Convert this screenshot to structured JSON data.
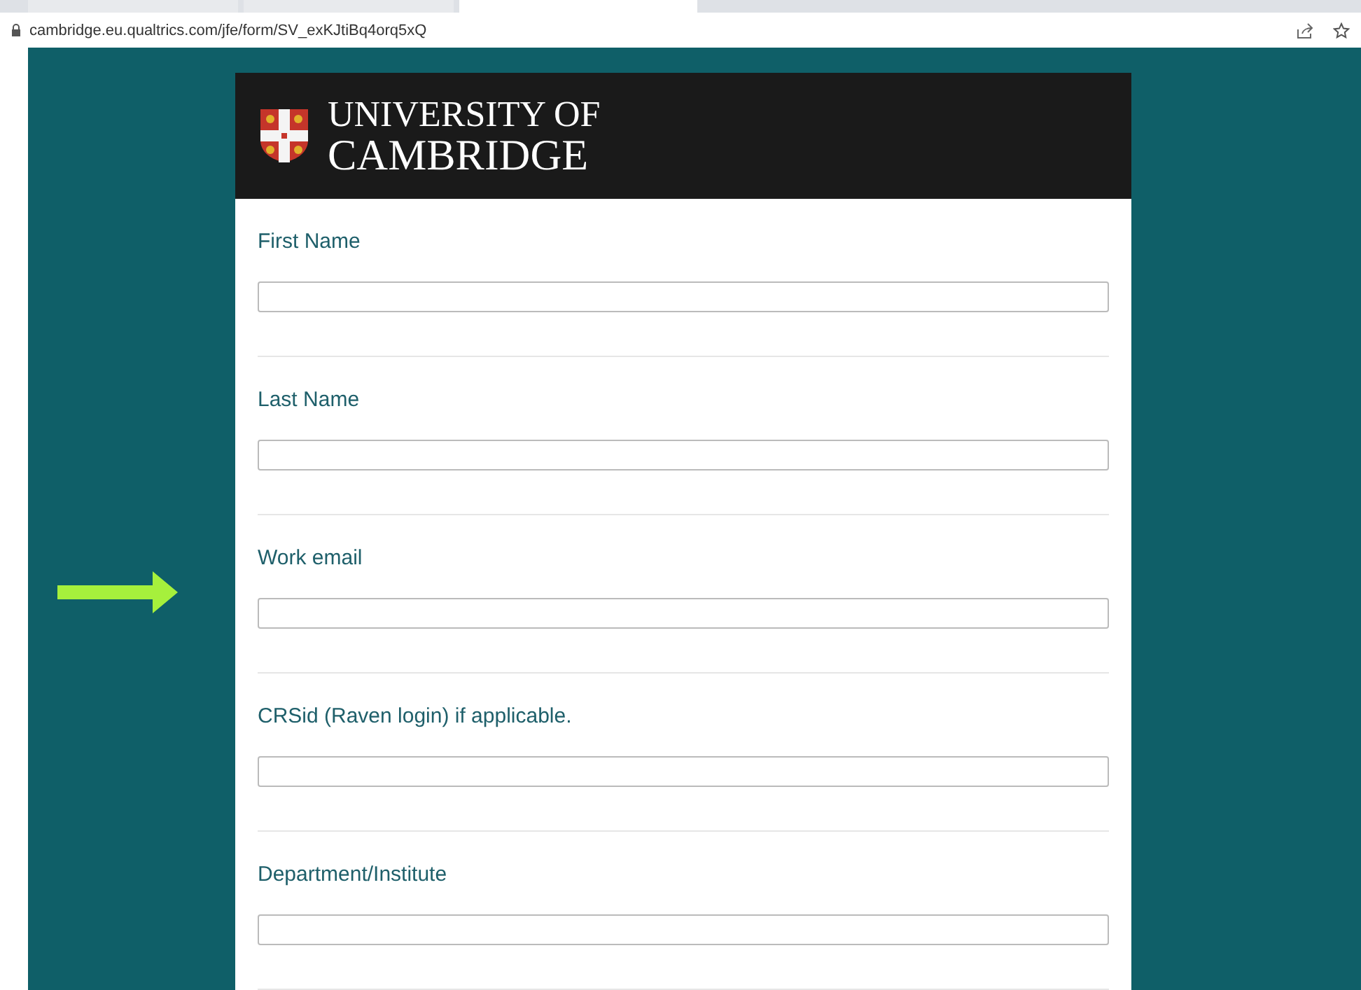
{
  "browser": {
    "tabs": [
      {
        "selected": false
      },
      {
        "selected": false
      },
      {
        "selected": true
      }
    ],
    "url": "cambridge.eu.qualtrics.com/jfe/form/SV_exKJtiBq4orq5xQ"
  },
  "header": {
    "logo_line_1": "UNIVERSITY OF",
    "logo_line_2": "CAMBRIDGE"
  },
  "questions": [
    {
      "label": "First Name"
    },
    {
      "label": "Last Name"
    },
    {
      "label": "Work email"
    },
    {
      "label": "CRSid (Raven login) if applicable."
    },
    {
      "label": "Department/Institute"
    }
  ]
}
